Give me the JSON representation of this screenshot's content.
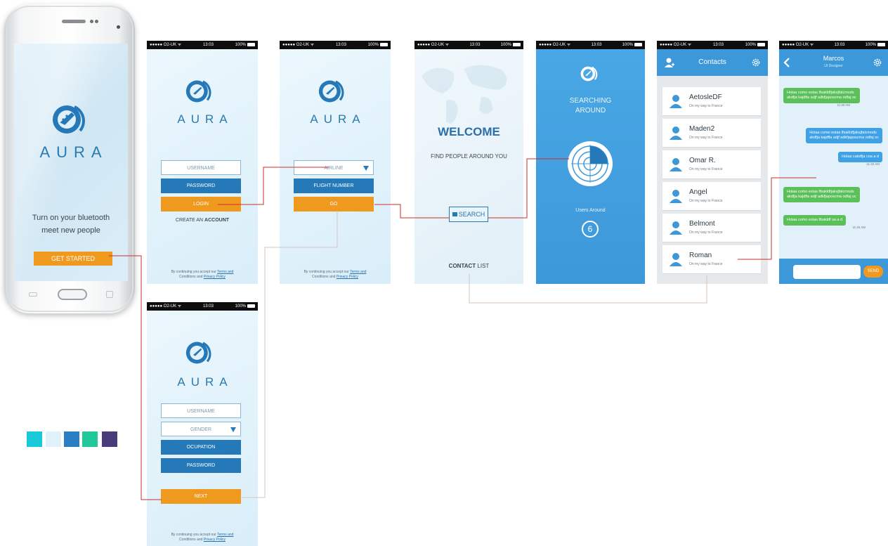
{
  "app": {
    "logo_text": "AURA",
    "colors": {
      "brand_blue": "#2579b8",
      "orange": "#ef9a1f",
      "connector": "#c9302c",
      "chat_green": "#5bc05a",
      "chat_blue": "#3fa1e6"
    }
  },
  "status": {
    "carrier": "●●●●● O2-UK ᯤ",
    "time": "13:03",
    "battery": "100%"
  },
  "phone_screen": {
    "tagline_1": "Turn on your bluetooth",
    "tagline_2": "meet new people",
    "cta": "GET STARTED"
  },
  "terms": {
    "line_1_prefix": "By continuing you accept our",
    "terms_link": "Terms and",
    "line_2_prefix": "Conditions",
    "line_2_and": "and",
    "privacy_link": "Privacy Policy"
  },
  "login": {
    "username_placeholder": "USERNAME",
    "password_placeholder": "PASSWORD",
    "login_button": "LOGIN",
    "create_account_prefix": "CREATE AN",
    "create_account_strong": "ACCOUNT"
  },
  "flight": {
    "airline_select": "AIRLINE",
    "flight_number_placeholder": "FLIGHT NUMBER",
    "go_button": "GO"
  },
  "welcome": {
    "title": "WELCOME",
    "subtitle": "FIND PEOPLE AROUND YOU",
    "search_button": "SEARCH",
    "contact_strong": "CONTACT",
    "contact_rest": "LIST"
  },
  "searching": {
    "title_1": "SEARCHING",
    "title_2": "AROUND",
    "users_label": "Users Around",
    "users_count": "6"
  },
  "contacts": {
    "title": "Contacts",
    "items": [
      {
        "name": "AetosleDF",
        "status": "On my way to France"
      },
      {
        "name": "Maden2",
        "status": "On my way to France"
      },
      {
        "name": "Omar R.",
        "status": "On my way to France"
      },
      {
        "name": "Angel",
        "status": "On my way to France"
      },
      {
        "name": "Belmont",
        "status": "On my way to France"
      },
      {
        "name": "Roman",
        "status": "On my way to France"
      }
    ]
  },
  "chat": {
    "name": "Marcos",
    "role": "UI Designer",
    "messages": [
      {
        "side": "left",
        "line_1": "Holaa como estas lfsakldfjaksjfalcmods",
        "line_2": "akdfja kajdfla adjf adkfjaposcma odfaj oc",
        "time": "11:30 AM"
      },
      {
        "side": "right",
        "line_1": "Holaa como estas lfsakldfjaksjfalcmods",
        "line_2": "akdfja kajdfla adjf adkfjaposcma odfaj oc",
        "time": ""
      },
      {
        "side": "right",
        "line_1": "Holaa cakdfja coa a d",
        "line_2": "",
        "time": "11:40 AM"
      },
      {
        "side": "left",
        "line_1": "Holaa como estas lfsakldfjaksjfalcmods",
        "line_2": "akdfja kajdfla adjf adkfjaposcma odfaj oc",
        "time": ""
      },
      {
        "side": "left",
        "line_1": "Holaa como estas lfsakldf sa a d",
        "line_2": "",
        "time": "11:45 AM"
      }
    ],
    "send_button": "SEND",
    "input_value": ""
  },
  "signup": {
    "username_placeholder": "USERNAME",
    "gender_select": "GENDER",
    "occupation_placeholder": "OCUPATION",
    "password_placeholder": "PASSWORD",
    "next_button": "NEXT"
  },
  "palette": [
    "#18c9d8",
    "#e0f1fb",
    "#2a7fc4",
    "#22c79a",
    "#4a3b7a"
  ]
}
